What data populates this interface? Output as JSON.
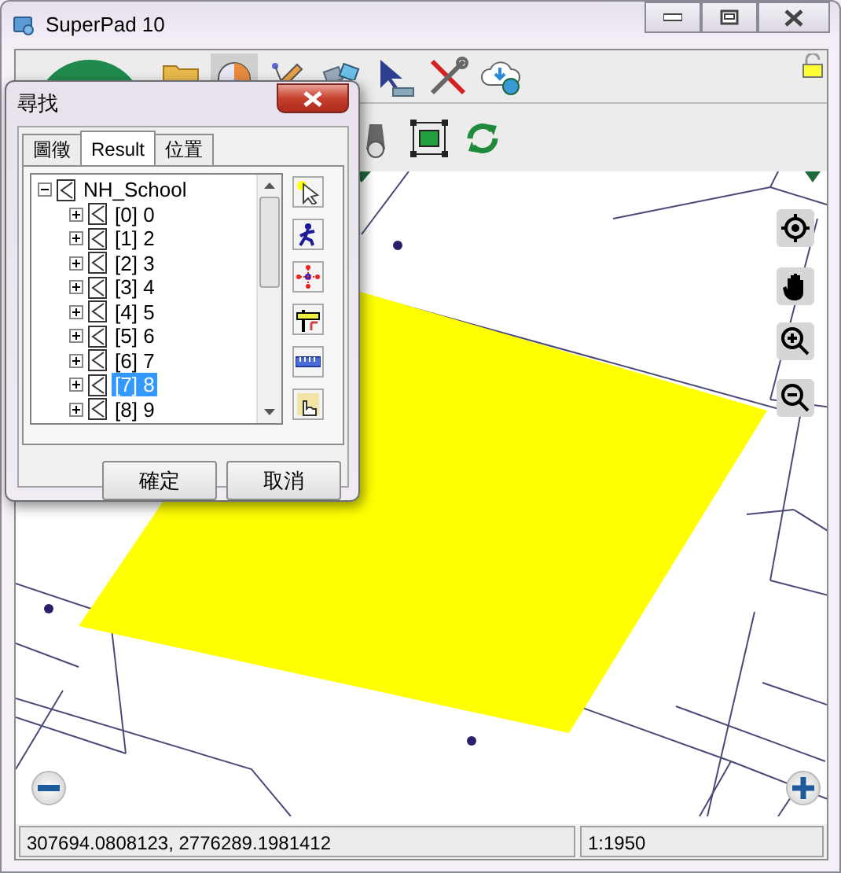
{
  "window": {
    "title": "SuperPad 10"
  },
  "dialog": {
    "title": "尋找",
    "tabs": [
      {
        "label": "圖徵",
        "selected": false
      },
      {
        "label": "Result",
        "selected": true
      },
      {
        "label": "位置",
        "selected": false
      }
    ],
    "tree": {
      "label": "NH_School",
      "expanded": true,
      "children": [
        {
          "label": "[0] 0",
          "expanded": false,
          "selected": false
        },
        {
          "label": "[1] 2",
          "expanded": false,
          "selected": false
        },
        {
          "label": "[2] 3",
          "expanded": false,
          "selected": false
        },
        {
          "label": "[3] 4",
          "expanded": false,
          "selected": false
        },
        {
          "label": "[4] 5",
          "expanded": false,
          "selected": false
        },
        {
          "label": "[5] 6",
          "expanded": false,
          "selected": false
        },
        {
          "label": "[6] 7",
          "expanded": false,
          "selected": false
        },
        {
          "label": "[7] 8",
          "expanded": false,
          "selected": true
        },
        {
          "label": "[8] 9",
          "expanded": false,
          "selected": false
        }
      ]
    },
    "buttons": [
      "確定",
      "取消"
    ]
  },
  "status_bar": {
    "coordinates": "307694.0808123, 2776289.1981412",
    "scale": "1:1950"
  }
}
